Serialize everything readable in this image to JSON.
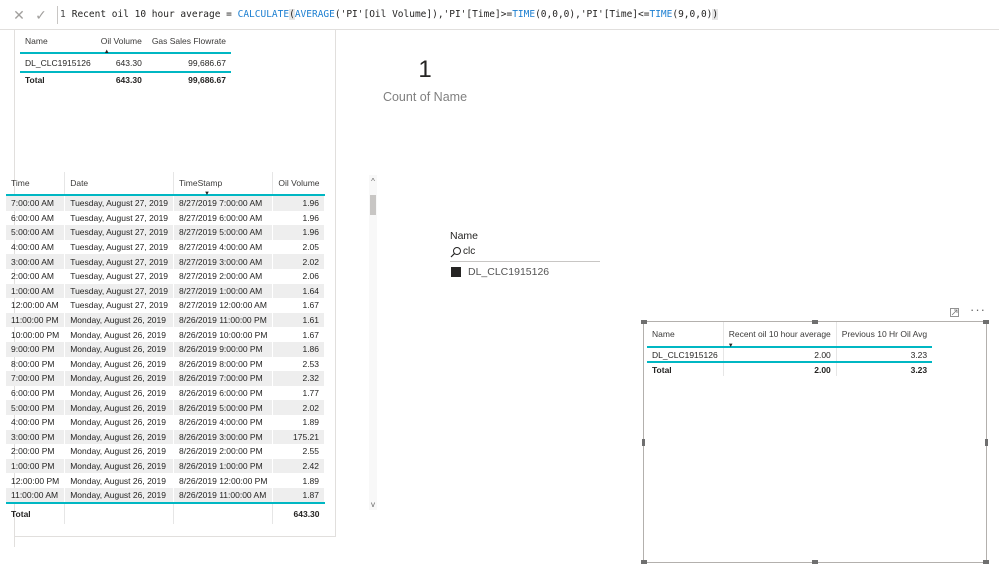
{
  "formula_bar": {
    "cancel_icon": "close-icon",
    "commit_icon": "check-icon",
    "line_number": "1",
    "measure_name": "Recent oil 10 hour average = ",
    "fn_calculate": "CALCULATE",
    "paren_open": "(",
    "fn_average": "AVERAGE",
    "arg_column": "('PI'[Oil Volume]),'PI'[Time]>=",
    "fn_time1": "TIME",
    "time1_args": "(0,0,0),'PI'[Time]<=",
    "fn_time2": "TIME",
    "time2_args": "(9,0,0)",
    "paren_close": ")"
  },
  "table_top": {
    "headers": [
      "Name",
      "Oil Volume",
      "Gas Sales Flowrate"
    ],
    "rows": [
      [
        "DL_CLC1915126",
        "643.30",
        "99,686.67"
      ]
    ],
    "total": [
      "Total",
      "643.30",
      "99,686.67"
    ]
  },
  "card": {
    "value": "1",
    "label": "Count of Name"
  },
  "table_main": {
    "headers": [
      "Time",
      "Date",
      "TimeStamp",
      "Oil Volume"
    ],
    "rows": [
      [
        "7:00:00 AM",
        "Tuesday, August 27, 2019",
        "8/27/2019 7:00:00 AM",
        "1.96"
      ],
      [
        "6:00:00 AM",
        "Tuesday, August 27, 2019",
        "8/27/2019 6:00:00 AM",
        "1.96"
      ],
      [
        "5:00:00 AM",
        "Tuesday, August 27, 2019",
        "8/27/2019 5:00:00 AM",
        "1.96"
      ],
      [
        "4:00:00 AM",
        "Tuesday, August 27, 2019",
        "8/27/2019 4:00:00 AM",
        "2.05"
      ],
      [
        "3:00:00 AM",
        "Tuesday, August 27, 2019",
        "8/27/2019 3:00:00 AM",
        "2.02"
      ],
      [
        "2:00:00 AM",
        "Tuesday, August 27, 2019",
        "8/27/2019 2:00:00 AM",
        "2.06"
      ],
      [
        "1:00:00 AM",
        "Tuesday, August 27, 2019",
        "8/27/2019 1:00:00 AM",
        "1.64"
      ],
      [
        "12:00:00 AM",
        "Tuesday, August 27, 2019",
        "8/27/2019 12:00:00 AM",
        "1.67"
      ],
      [
        "11:00:00 PM",
        "Monday, August 26, 2019",
        "8/26/2019 11:00:00 PM",
        "1.61"
      ],
      [
        "10:00:00 PM",
        "Monday, August 26, 2019",
        "8/26/2019 10:00:00 PM",
        "1.67"
      ],
      [
        "9:00:00 PM",
        "Monday, August 26, 2019",
        "8/26/2019 9:00:00 PM",
        "1.86"
      ],
      [
        "8:00:00 PM",
        "Monday, August 26, 2019",
        "8/26/2019 8:00:00 PM",
        "2.53"
      ],
      [
        "7:00:00 PM",
        "Monday, August 26, 2019",
        "8/26/2019 7:00:00 PM",
        "2.32"
      ],
      [
        "6:00:00 PM",
        "Monday, August 26, 2019",
        "8/26/2019 6:00:00 PM",
        "1.77"
      ],
      [
        "5:00:00 PM",
        "Monday, August 26, 2019",
        "8/26/2019 5:00:00 PM",
        "2.02"
      ],
      [
        "4:00:00 PM",
        "Monday, August 26, 2019",
        "8/26/2019 4:00:00 PM",
        "1.89"
      ],
      [
        "3:00:00 PM",
        "Monday, August 26, 2019",
        "8/26/2019 3:00:00 PM",
        "175.21"
      ],
      [
        "2:00:00 PM",
        "Monday, August 26, 2019",
        "8/26/2019 2:00:00 PM",
        "2.55"
      ],
      [
        "1:00:00 PM",
        "Monday, August 26, 2019",
        "8/26/2019 1:00:00 PM",
        "2.42"
      ],
      [
        "12:00:00 PM",
        "Monday, August 26, 2019",
        "8/26/2019 12:00:00 PM",
        "1.89"
      ],
      [
        "11:00:00 AM",
        "Monday, August 26, 2019",
        "8/26/2019 11:00:00 AM",
        "1.87"
      ]
    ],
    "total": [
      "Total",
      "",
      "",
      "643.30"
    ]
  },
  "slicer": {
    "title": "Name",
    "search_value": "clc",
    "items": [
      {
        "label": "DL_CLC1915126",
        "selected": true
      }
    ]
  },
  "table_right": {
    "headers": [
      "Name",
      "Recent oil 10 hour average",
      "Previous 10 Hr Oil Avg"
    ],
    "rows": [
      [
        "DL_CLC1915126",
        "2.00",
        "3.23"
      ]
    ],
    "total": [
      "Total",
      "2.00",
      "3.23"
    ],
    "header_icons": [
      "focus-mode-icon",
      "more-options-icon"
    ]
  },
  "colors": {
    "accent": "#00b7c3",
    "formula_function": "#1c7fd1",
    "row_band": "#eeeeee"
  }
}
